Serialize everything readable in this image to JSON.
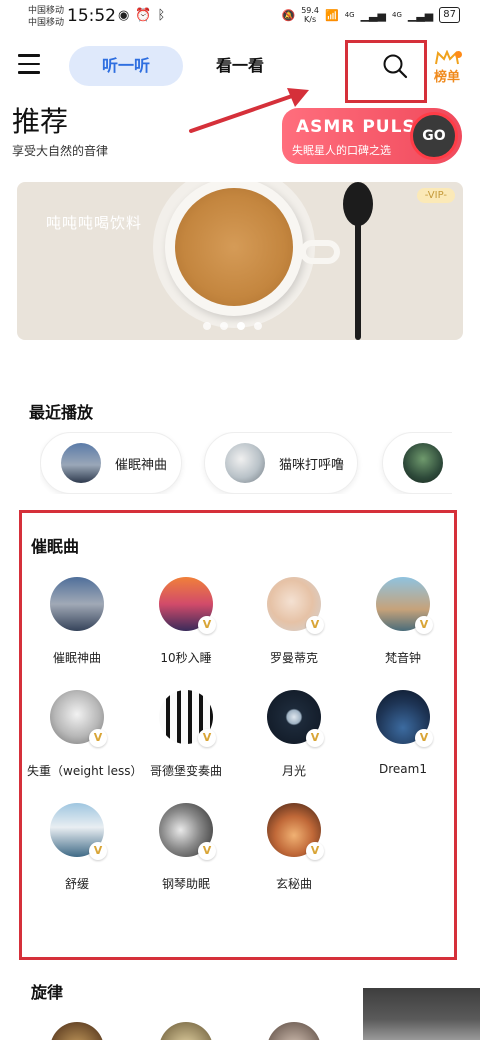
{
  "status": {
    "carrier1": "中国移动",
    "carrier2": "中国移动",
    "time": "15:52",
    "net_value": "59.4",
    "net_unit": "K/s",
    "signal_a": "4G",
    "signal_b": "4G",
    "battery": "87"
  },
  "nav": {
    "tab_listen": "听一听",
    "tab_watch": "看一看",
    "rank_label": "榜单"
  },
  "header": {
    "title": "推荐",
    "subtitle": "享受大自然的音律"
  },
  "promo": {
    "title": "ASMR PULS",
    "subtitle": "失眠星人的口碑之选",
    "go_label": "GO"
  },
  "banner": {
    "text": "吨吨吨喝饮料",
    "badge": "-VIP-",
    "slide_count": 4,
    "active_slide": 3
  },
  "recent": {
    "title": "最近播放",
    "items": [
      {
        "label": "催眠神曲"
      },
      {
        "label": "猫咪打呼噜"
      },
      {
        "label": ""
      }
    ]
  },
  "hypnosis": {
    "title": "催眠曲",
    "items": [
      {
        "label": "催眠神曲",
        "vip": ""
      },
      {
        "label": "10秒入睡",
        "vip": "V"
      },
      {
        "label": "罗曼蒂克",
        "vip": "V"
      },
      {
        "label": "梵音钟",
        "vip": "V"
      },
      {
        "label": "失重（weight less）",
        "vip": "V"
      },
      {
        "label": "哥德堡变奏曲",
        "vip": "V"
      },
      {
        "label": "月光",
        "vip": "V"
      },
      {
        "label": "Dream1",
        "vip": "V"
      },
      {
        "label": "舒缓",
        "vip": "V"
      },
      {
        "label": "钢琴助眠",
        "vip": "V"
      },
      {
        "label": "玄秘曲",
        "vip": "V"
      }
    ]
  },
  "melody": {
    "title": "旋律"
  },
  "colors": {
    "accent_blue": "#2f6fe0",
    "highlight_red": "#d5303a",
    "promo_red": "#f04a5c",
    "rank_orange": "#f08a1c",
    "vip_gold": "#d9a537"
  }
}
